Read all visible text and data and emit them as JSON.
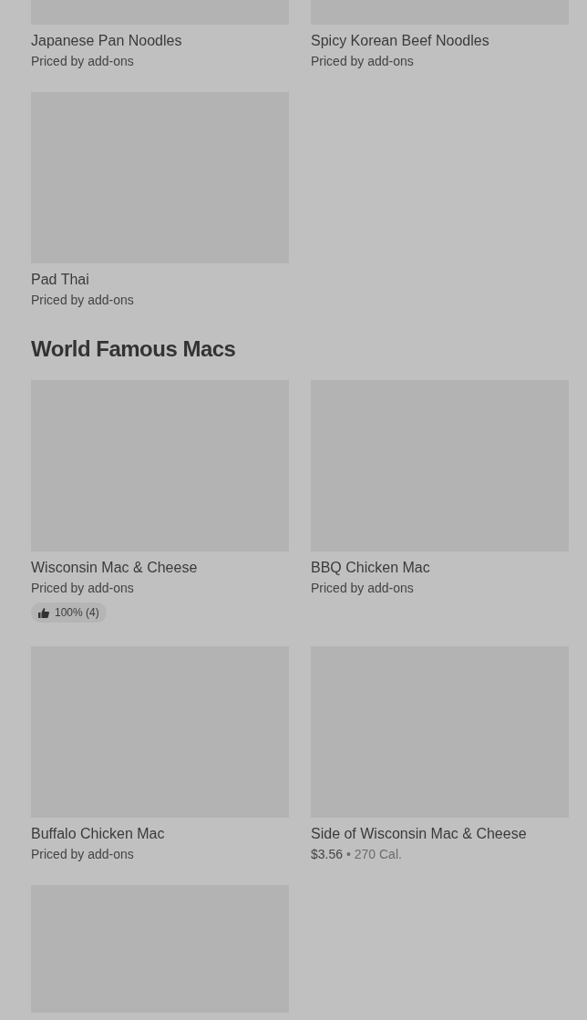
{
  "sections": [
    {
      "items": [
        {
          "name": "Japanese Pan Noodles",
          "price": "Priced by add-ons",
          "kind": "picture"
        },
        {
          "name": "Spicy Korean Beef Noodles",
          "price": "Priced by add-ons",
          "kind": "picture"
        },
        {
          "name": "Pad Thai",
          "price": "Priced by add-ons",
          "kind": "picture"
        }
      ]
    },
    {
      "title": "World Famous Macs",
      "items": [
        {
          "name": "Wisconsin Mac & Cheese",
          "price": "Priced by add-ons",
          "rating": "100% (4)",
          "kind": "picture"
        },
        {
          "name": "BBQ Chicken Mac",
          "price": "Priced by add-ons",
          "kind": "picture"
        },
        {
          "name": "Buffalo Chicken Mac",
          "price": "Priced by add-ons",
          "kind": "picture"
        },
        {
          "name": "Side of Wisconsin Mac & Cheese",
          "price": "$3.56",
          "separator": "•",
          "calories": "270 Cal.",
          "kind": "picture"
        },
        {
          "kind": "picture"
        }
      ]
    }
  ]
}
